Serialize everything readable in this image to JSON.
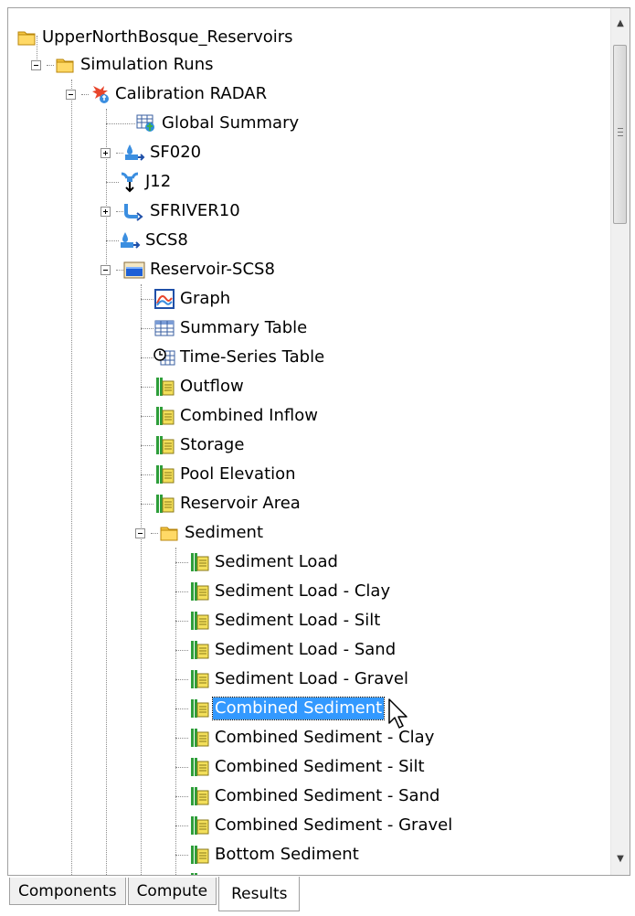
{
  "tree": {
    "root_label": "UpperNorthBosque_Reservoirs",
    "simulation_runs_label": "Simulation Runs",
    "run_label": "Calibration RADAR",
    "global_summary_label": "Global Summary",
    "elements": {
      "sf020": "SF020",
      "j12": "J12",
      "sfriver10": "SFRIVER10",
      "scs8": "SCS8",
      "reservoir": "Reservoir-SCS8"
    },
    "reservoir_items": [
      "Graph",
      "Summary Table",
      "Time-Series Table",
      "Outflow",
      "Combined Inflow",
      "Storage",
      "Pool Elevation",
      "Reservoir Area"
    ],
    "sediment_folder_label": "Sediment",
    "sediment_items": [
      "Sediment Load",
      "Sediment Load - Clay",
      "Sediment Load - Silt",
      "Sediment Load - Sand",
      "Sediment Load - Gravel",
      "Combined Sediment",
      "Combined Sediment - Clay",
      "Combined Sediment - Silt",
      "Combined Sediment - Sand",
      "Combined Sediment - Gravel",
      "Bottom Sediment"
    ],
    "selected_item": "Combined Sediment"
  },
  "tabs": [
    "Components",
    "Compute",
    "Results"
  ],
  "active_tab": "Results",
  "colors": {
    "selection": "#3399ff",
    "folder": "#f5c542",
    "series_green": "#2e9e3a",
    "series_yellow": "#f3df5a"
  }
}
